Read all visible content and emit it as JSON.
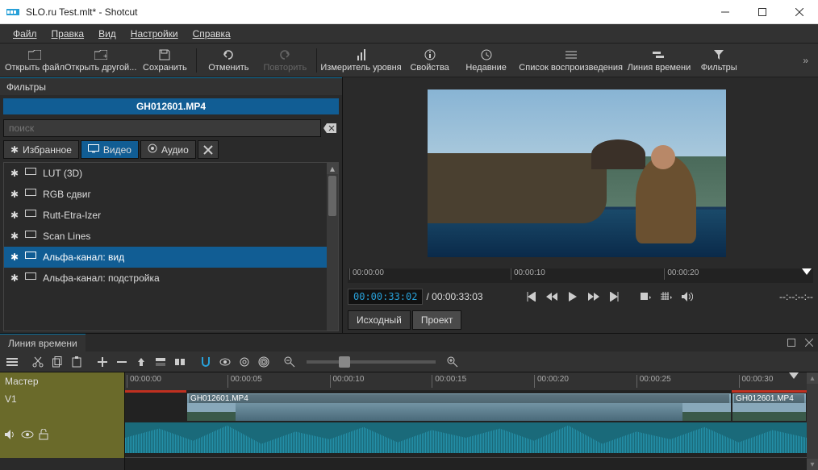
{
  "window": {
    "title": "SLO.ru Test.mlt* - Shotcut"
  },
  "menu": {
    "items": [
      "Файл",
      "Правка",
      "Вид",
      "Настройки",
      "Справка"
    ]
  },
  "toolbar": {
    "open": "Открыть файл",
    "open_other": "Открыть другой...",
    "save": "Сохранить",
    "undo": "Отменить",
    "redo": "Повторить",
    "peak": "Измеритель уровня",
    "properties": "Свойства",
    "recent": "Недавние",
    "playlist": "Список воспроизведения",
    "timeline": "Линия времени",
    "filters": "Фильтры"
  },
  "filters": {
    "panel_title": "Фильтры",
    "clip": "GH012601.MP4",
    "search_placeholder": "поиск",
    "tabs": {
      "fav": "Избранное",
      "video": "Видео",
      "audio": "Аудио"
    },
    "items": [
      "LUT (3D)",
      "RGB сдвиг",
      "Rutt-Etra-Izer",
      "Scan Lines",
      "Альфа-канал: вид",
      "Альфа-канал: подстройка"
    ],
    "selected_index": 4
  },
  "preview": {
    "tc_current": "00:00:33:02",
    "tc_total": "00:00:33:03",
    "tc_inout": "--:--:--:--",
    "ruler": [
      "00:00:00",
      "00:00:10",
      "00:00:20"
    ],
    "tabs": {
      "source": "Исходный",
      "project": "Проект"
    }
  },
  "timeline": {
    "panel_title": "Линия времени",
    "master": "Мастер",
    "track_v1": "V1",
    "ruler": [
      "00:00:00",
      "00:00:05",
      "00:00:10",
      "00:00:15",
      "00:00:20",
      "00:00:25",
      "00:00:30"
    ],
    "clips": [
      {
        "label": "GH012601.MP4",
        "start_pct": 9,
        "width_pct": 80
      },
      {
        "label": "GH012601.MP4",
        "start_pct": 89,
        "width_pct": 11
      }
    ]
  }
}
